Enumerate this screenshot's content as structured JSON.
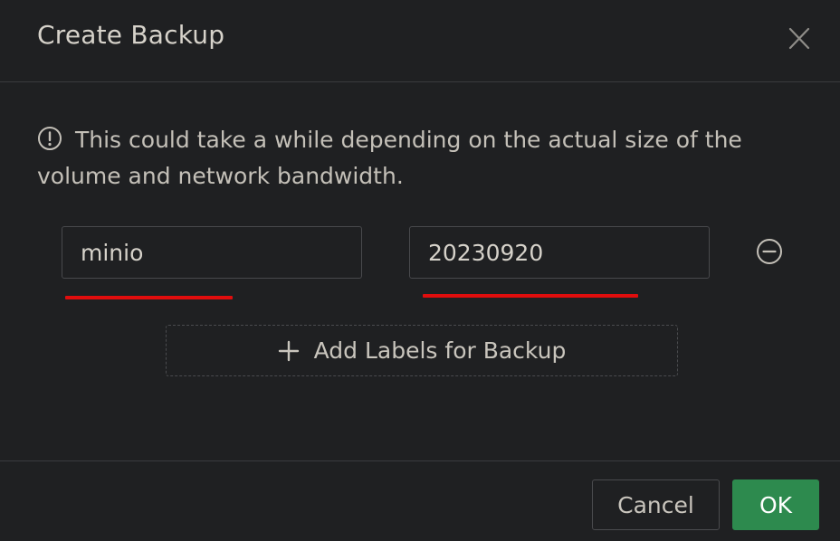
{
  "dialog": {
    "title": "Create Backup",
    "notice": "This could take a while depending on the actual size of the volume and network bandwidth.",
    "labels": [
      {
        "key": "minio",
        "value": "20230920"
      }
    ],
    "add_labels_label": "Add Labels for Backup",
    "cancel_label": "Cancel",
    "ok_label": "OK",
    "colors": {
      "background": "#1f2022",
      "accent_ok": "#2d8a4e",
      "annotation_underline": "#e00d0d"
    },
    "icons": {
      "close": "close-icon",
      "info": "info-circle-icon",
      "remove": "minus-circle-icon",
      "add": "plus-icon"
    }
  }
}
